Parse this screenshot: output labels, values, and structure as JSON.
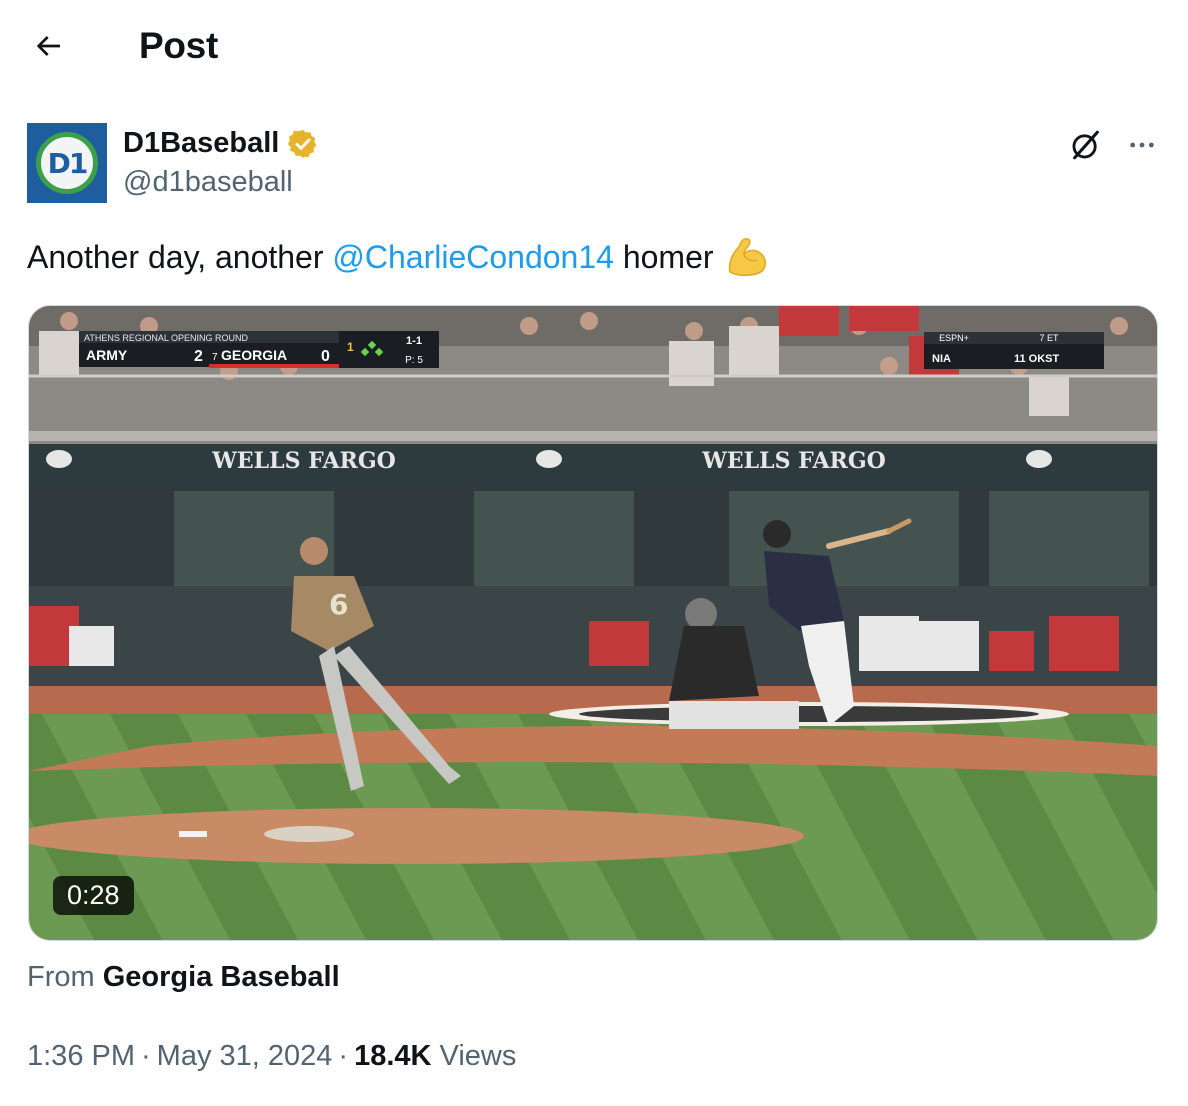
{
  "header": {
    "title": "Post"
  },
  "author": {
    "display_name": "D1Baseball",
    "handle": "@d1baseball",
    "avatar_text": "D1",
    "verified": true,
    "verified_color": "#e8b32c"
  },
  "tweet": {
    "text_before": "Another day, another ",
    "mention": "@CharlieCondon14",
    "text_after": " homer",
    "emoji": "flexed-biceps"
  },
  "media": {
    "duration": "0:28",
    "scorebug": {
      "header": "ATHENS REGIONAL OPENING ROUND",
      "away_team": "ARMY",
      "away_score": "2",
      "home_seed": "7",
      "home_team": "GEORGIA",
      "home_score": "0",
      "inning": "1",
      "count": "1-1",
      "pitches": "P: 5"
    },
    "right_bug": {
      "network": "ESPN+",
      "time": "7 ET",
      "team_a": "NIA",
      "team_b": "11 OKST"
    },
    "wall_sponsor": "WELLS FARGO"
  },
  "source": {
    "from_label": "From",
    "name": "Georgia Baseball"
  },
  "meta": {
    "time": "1:36 PM",
    "date": "May 31, 2024",
    "views_count": "18.4K",
    "views_label": "Views"
  },
  "colors": {
    "link": "#1d9bf0",
    "secondary_text": "#536471",
    "primary_text": "#0f1419"
  }
}
